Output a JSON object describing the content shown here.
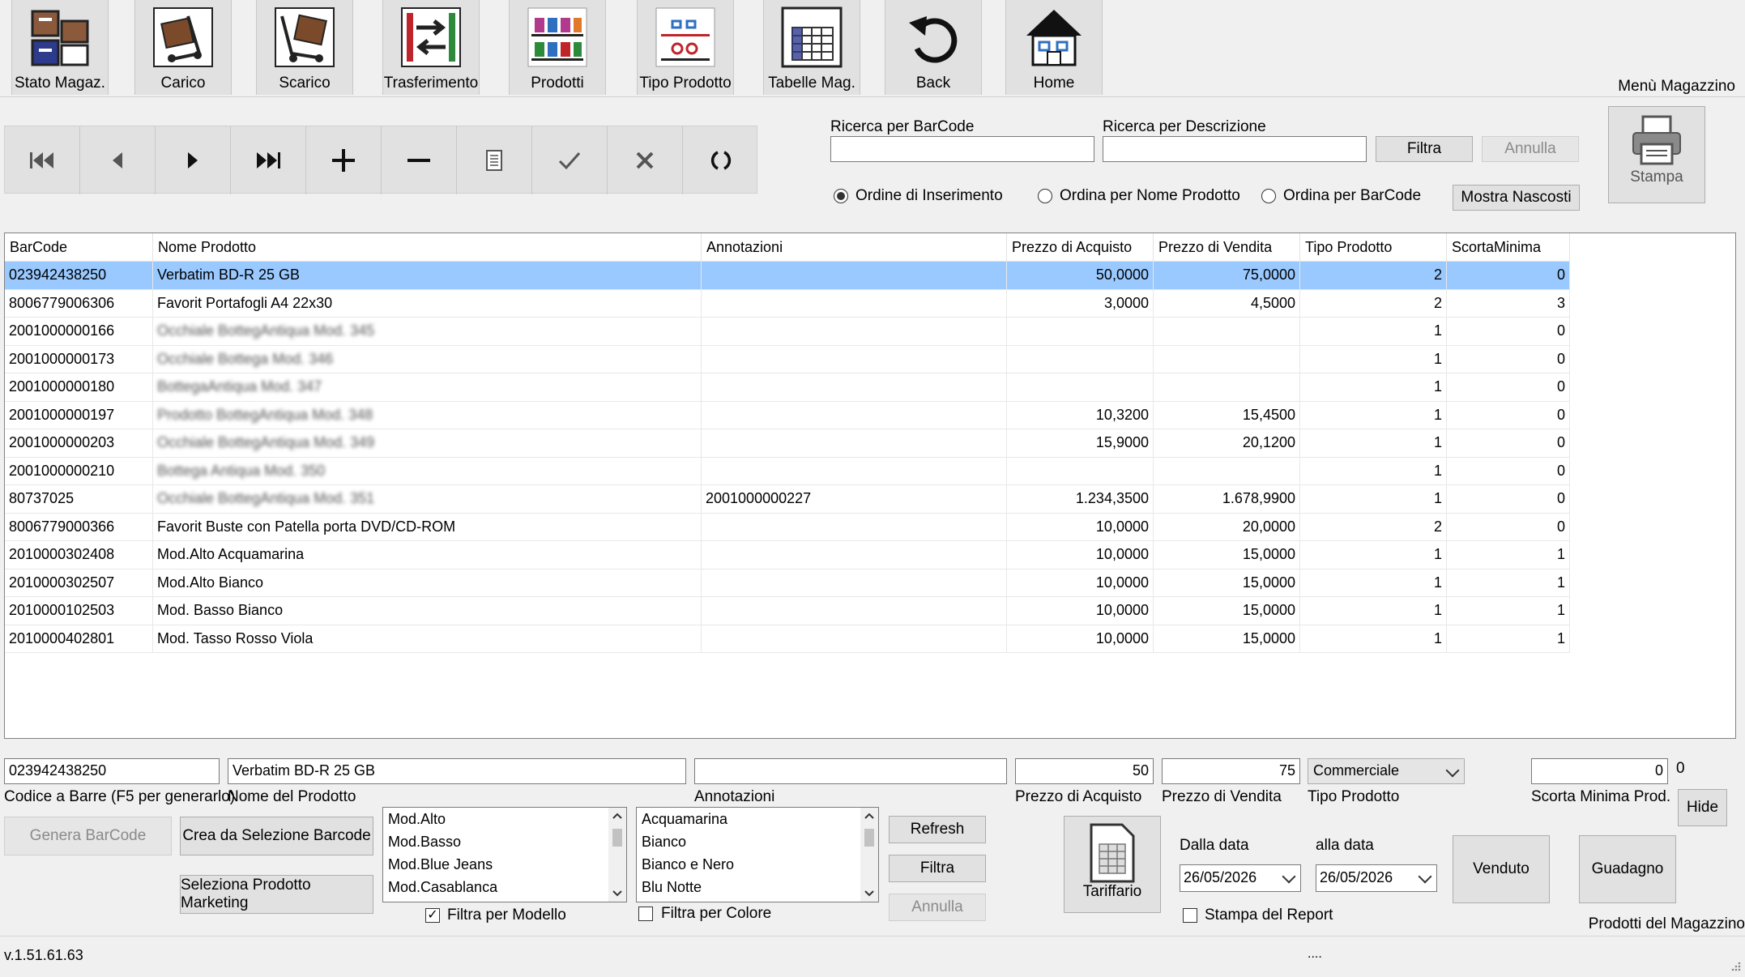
{
  "toolbar": {
    "items": [
      {
        "label": "Stato Magaz.",
        "icon": "warehouse-status-icon"
      },
      {
        "label": "Carico",
        "icon": "load-trolley-icon"
      },
      {
        "label": "Scarico",
        "icon": "unload-trolley-icon"
      },
      {
        "label": "Trasferimento",
        "icon": "transfer-arrows-icon"
      },
      {
        "label": "Prodotti",
        "icon": "products-shelf-icon"
      },
      {
        "label": "Tipo Prodotto",
        "icon": "product-type-glasses-icon"
      },
      {
        "label": "Tabelle Mag.",
        "icon": "tables-grid-icon"
      },
      {
        "label": "Back",
        "icon": "back-arrow-icon"
      },
      {
        "label": "Home",
        "icon": "home-icon"
      }
    ],
    "menu_title": "Menù Magazzino"
  },
  "search": {
    "barcode_label": "Ricerca per BarCode",
    "barcode_value": "",
    "desc_label": "Ricerca per Descrizione",
    "desc_value": "",
    "filter_button": "Filtra",
    "cancel_button": "Annulla",
    "print_label": "Stampa",
    "show_hidden_button": "Mostra Nascosti"
  },
  "sort": {
    "options": [
      "Ordine di Inserimento",
      "Ordina per Nome Prodotto",
      "Ordina per BarCode"
    ],
    "selected": 0
  },
  "grid": {
    "columns": [
      "BarCode",
      "Nome Prodotto",
      "Annotazioni",
      "Prezzo di Acquisto",
      "Prezzo di Vendita",
      "Tipo Prodotto",
      "ScortaMinima"
    ],
    "rows": [
      {
        "barcode": "023942438250",
        "name": "Verbatim BD-R 25 GB",
        "notes": "",
        "buy": "50,0000",
        "sell": "75,0000",
        "type": "2",
        "min": "0",
        "blur": false
      },
      {
        "barcode": "8006779006306",
        "name": "Favorit Portafogli A4 22x30",
        "notes": "",
        "buy": "3,0000",
        "sell": "4,5000",
        "type": "2",
        "min": "3",
        "blur": false
      },
      {
        "barcode": "2001000000166",
        "name": "Occhiale BottegAntiqua Mod. 345",
        "notes": "",
        "buy": "",
        "sell": "",
        "type": "1",
        "min": "0",
        "blur": true
      },
      {
        "barcode": "2001000000173",
        "name": "Occhiale Bottega Mod. 346",
        "notes": "",
        "buy": "",
        "sell": "",
        "type": "1",
        "min": "0",
        "blur": true
      },
      {
        "barcode": "2001000000180",
        "name": "BottegaAntiqua Mod. 347",
        "notes": "",
        "buy": "",
        "sell": "",
        "type": "1",
        "min": "0",
        "blur": true
      },
      {
        "barcode": "2001000000197",
        "name": "Prodotto BottegAntiqua Mod. 348",
        "notes": "",
        "buy": "10,3200",
        "sell": "15,4500",
        "type": "1",
        "min": "0",
        "blur": true
      },
      {
        "barcode": "2001000000203",
        "name": "Occhiale BottegAntiqua Mod. 349",
        "notes": "",
        "buy": "15,9000",
        "sell": "20,1200",
        "type": "1",
        "min": "0",
        "blur": true
      },
      {
        "barcode": "2001000000210",
        "name": "Bottega Antiqua Mod. 350",
        "notes": "",
        "buy": "",
        "sell": "",
        "type": "1",
        "min": "0",
        "blur": true
      },
      {
        "barcode": "80737025",
        "name": "Occhiale BottegAntiqua Mod. 351",
        "notes": "2001000000227",
        "buy": "1.234,3500",
        "sell": "1.678,9900",
        "type": "1",
        "min": "0",
        "blur": true
      },
      {
        "barcode": "8006779000366",
        "name": "Favorit Buste con Patella porta DVD/CD-ROM",
        "notes": "",
        "buy": "10,0000",
        "sell": "20,0000",
        "type": "2",
        "min": "0",
        "blur": false
      },
      {
        "barcode": "2010000302408",
        "name": "Mod.Alto Acquamarina",
        "notes": "",
        "buy": "10,0000",
        "sell": "15,0000",
        "type": "1",
        "min": "1",
        "blur": false
      },
      {
        "barcode": "2010000302507",
        "name": "Mod.Alto Bianco",
        "notes": "",
        "buy": "10,0000",
        "sell": "15,0000",
        "type": "1",
        "min": "1",
        "blur": false
      },
      {
        "barcode": "2010000102503",
        "name": "Mod. Basso Bianco",
        "notes": "",
        "buy": "10,0000",
        "sell": "15,0000",
        "type": "1",
        "min": "1",
        "blur": false
      },
      {
        "barcode": "2010000402801",
        "name": "Mod. Tasso Rosso Viola",
        "notes": "",
        "buy": "10,0000",
        "sell": "15,0000",
        "type": "1",
        "min": "1",
        "blur": false
      }
    ],
    "selected_row": 0
  },
  "detail": {
    "barcode_value": "023942438250",
    "barcode_label": "Codice a Barre (F5 per generarlo)",
    "name_value": "Verbatim BD-R 25 GB",
    "name_label": "Nome del Prodotto",
    "notes_value": "",
    "notes_label": "Annotazioni",
    "buy_value": "50",
    "buy_label": "Prezzo di Acquisto",
    "sell_value": "75",
    "sell_label": "Prezzo di Vendita",
    "type_value": "Commerciale",
    "type_label": "Tipo Prodotto",
    "min_value": "0",
    "min_label": "Scorta Minima Prod.",
    "min_extra": "0",
    "hide_button": "Hide"
  },
  "actions": {
    "generate_barcode": "Genera BarCode",
    "create_from_selection": "Crea da Selezione Barcode",
    "select_marketing": "Seleziona Prodotto Marketing",
    "refresh": "Refresh",
    "filter": "Filtra",
    "cancel": "Annulla",
    "filter_model_label": "Filtra per Modello",
    "filter_color_label": "Filtra per Colore",
    "models": [
      "Mod.Alto",
      "Mod.Basso",
      "Mod.Blue Jeans",
      "Mod.Casablanca"
    ],
    "colors": [
      "Acquamarina",
      "Bianco",
      "Bianco e Nero",
      "Blu Notte"
    ]
  },
  "report": {
    "tariff_label": "Tariffario",
    "from_label": "Dalla data",
    "from_value": "26/05/2026",
    "to_label": "alla data",
    "to_value": "26/05/2026",
    "print_report_label": "Stampa del Report",
    "sold_button": "Venduto",
    "profit_button": "Guadagno",
    "section_title": "Prodotti del Magazzino"
  },
  "status": {
    "version": "v.1.51.61.63",
    "middle": "...."
  }
}
